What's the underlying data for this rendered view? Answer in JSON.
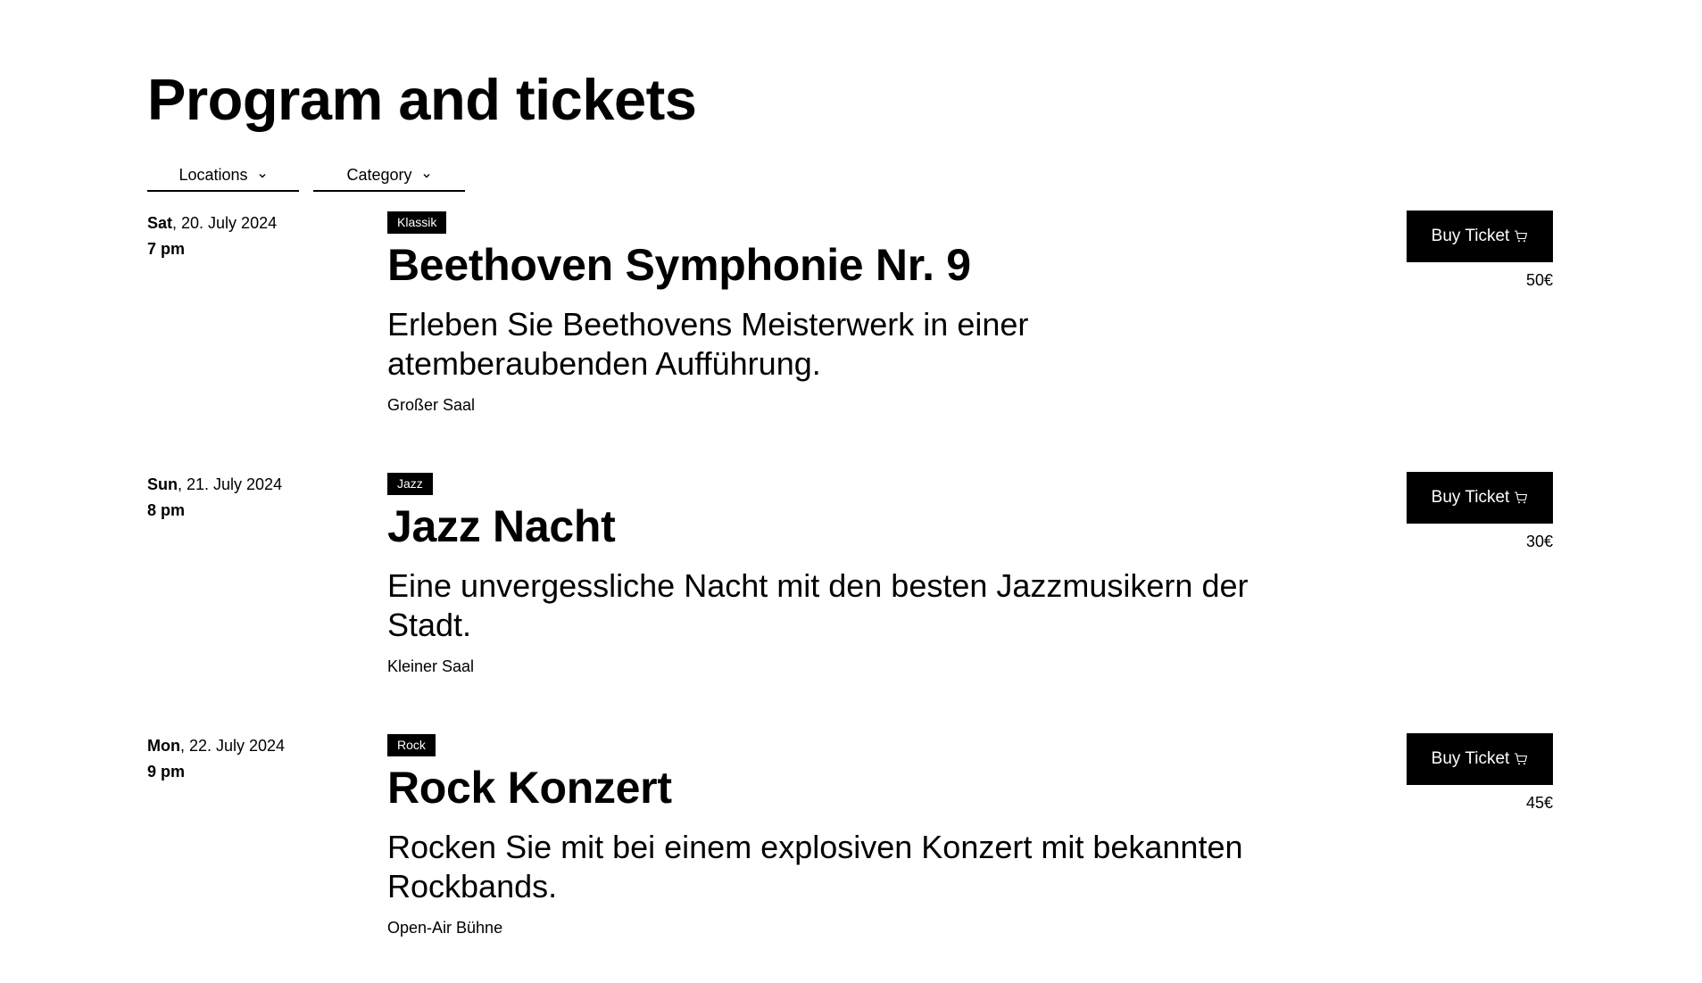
{
  "page": {
    "title": "Program and tickets"
  },
  "filters": {
    "locations_label": "Locations",
    "category_label": "Category"
  },
  "events": [
    {
      "day": "Sat",
      "date": ", 20. July 2024",
      "time": "7 pm",
      "category": "Klassik",
      "title": "Beethoven Symphonie Nr. 9",
      "description": "Erleben Sie Beethovens Meisterwerk in einer atemberaubenden Aufführung.",
      "venue": "Großer Saal",
      "button_label": "Buy Ticket",
      "price": "50€"
    },
    {
      "day": "Sun",
      "date": ", 21. July 2024",
      "time": "8 pm",
      "category": "Jazz",
      "title": "Jazz Nacht",
      "description": "Eine unvergessliche Nacht mit den besten Jazzmusikern der Stadt.",
      "venue": "Kleiner Saal",
      "button_label": "Buy Ticket",
      "price": "30€"
    },
    {
      "day": "Mon",
      "date": ", 22. July 2024",
      "time": "9 pm",
      "category": "Rock",
      "title": "Rock Konzert",
      "description": "Rocken Sie mit bei einem explosiven Konzert mit bekannten Rockbands.",
      "venue": "Open-Air Bühne",
      "button_label": "Buy Ticket",
      "price": "45€"
    }
  ],
  "icons": {
    "filter_chevron": "chevron-down-icon",
    "cart": "cart-icon"
  },
  "colors": {
    "text": "#000000",
    "background": "#ffffff",
    "button_bg": "#000000",
    "button_text": "#ffffff"
  }
}
